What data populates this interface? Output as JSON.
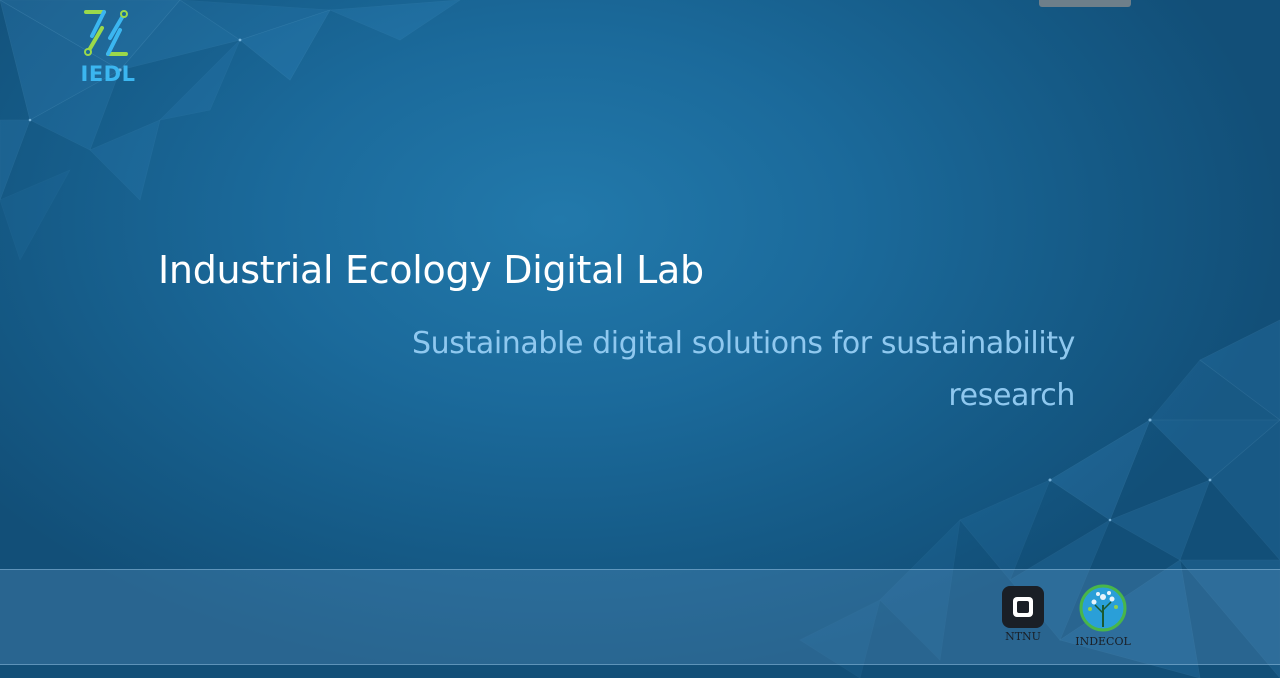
{
  "header": {
    "logo_text": "IEDL",
    "logo_icon": "iedl-logo-icon"
  },
  "hero": {
    "title": "Industrial Ecology Digital Lab",
    "subtitle": "Sustainable digital solutions for sustainability research"
  },
  "footer": {
    "partners": [
      {
        "label": "NTNU",
        "icon": "ntnu-logo-icon"
      },
      {
        "label": "INDECOL",
        "icon": "indecol-logo-icon"
      }
    ]
  },
  "colors": {
    "background": "#1b6a9b",
    "title": "#ffffff",
    "subtitle": "#8fc8ef",
    "logo_text": "#3bb6f0",
    "logo_green": "#9bd94b"
  }
}
